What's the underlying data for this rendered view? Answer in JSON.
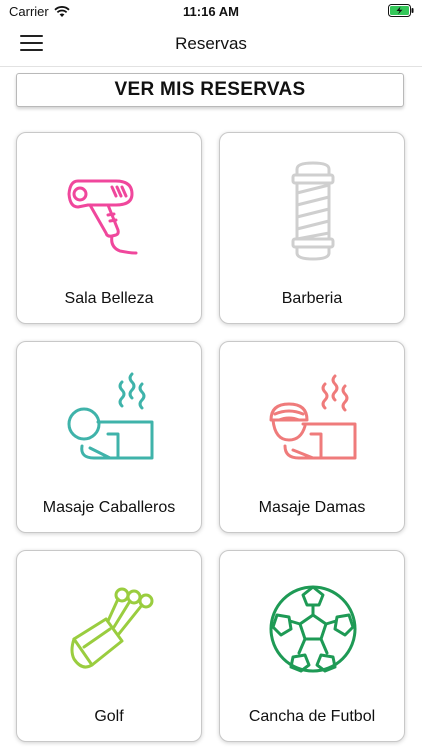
{
  "status": {
    "carrier": "Carrier",
    "time": "11:16 AM"
  },
  "nav": {
    "title": "Reservas",
    "menu_icon": "hamburger-icon"
  },
  "reservas_button": {
    "label": "VER MIS RESERVAS"
  },
  "services": [
    {
      "label": "Sala Belleza",
      "icon": "hair-dryer-icon",
      "color": "#f0479c"
    },
    {
      "label": "Barberia",
      "icon": "barber-pole-icon",
      "color": "#cfcfcf"
    },
    {
      "label": "Masaje Caballeros",
      "icon": "massage-icon",
      "color": "#3fb3aa"
    },
    {
      "label": "Masaje Damas",
      "icon": "massage-towel-icon",
      "color": "#ef7b7b"
    },
    {
      "label": "Golf",
      "icon": "golf-bag-icon",
      "color": "#9acd3f"
    },
    {
      "label": "Cancha de Futbol",
      "icon": "soccer-ball-icon",
      "color": "#1e9a55"
    }
  ]
}
